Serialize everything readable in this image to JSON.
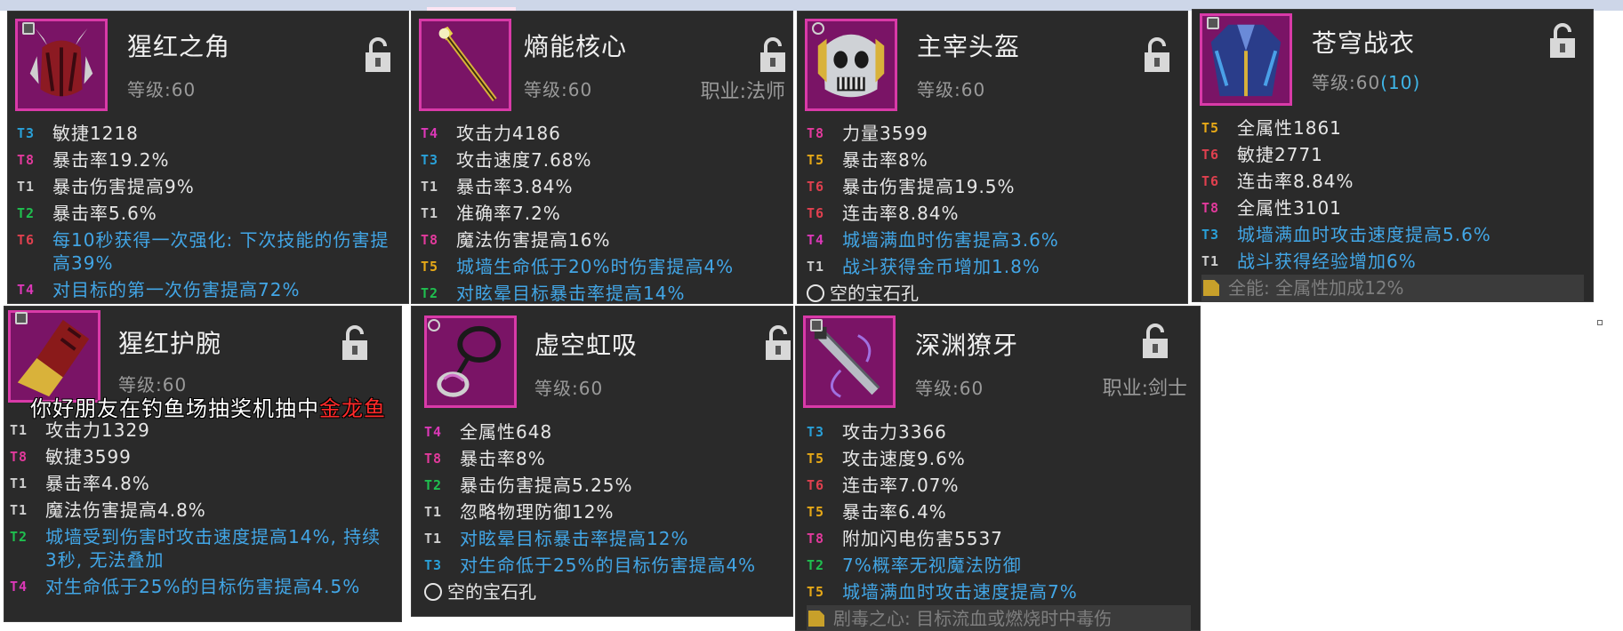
{
  "cards": [
    {
      "name": "猩红之角",
      "level": "等级:60",
      "level_bonus": "",
      "class_label": "",
      "icon": "horned-helm-icon",
      "stats": [
        {
          "tier": "T3",
          "text": "敏捷1218"
        },
        {
          "tier": "T8",
          "text": "暴击率19.2%"
        },
        {
          "tier": "T1",
          "text": "暴击伤害提高9%"
        },
        {
          "tier": "T2",
          "text": "暴击率5.6%"
        },
        {
          "tier": "T6",
          "text": "每10秒获得一次强化: 下次技能的伤害提高39%"
        },
        {
          "tier": "T4",
          "text": "对目标的第一次伤害提高72%"
        }
      ]
    },
    {
      "name": "熵能核心",
      "level": "等级:60",
      "level_bonus": "",
      "class_label": "职业:法师",
      "icon": "staff-icon",
      "stats": [
        {
          "tier": "T4",
          "text": "攻击力4186"
        },
        {
          "tier": "T3",
          "text": "攻击速度7.68%"
        },
        {
          "tier": "T1",
          "text": "暴击率3.84%"
        },
        {
          "tier": "T1",
          "text": "准确率7.2%"
        },
        {
          "tier": "T8",
          "text": "魔法伤害提高16%"
        },
        {
          "tier": "T5",
          "text": "城墙生命低于20%时伤害提高4%"
        },
        {
          "tier": "T2",
          "text": "对眩晕目标暴击率提高14%"
        }
      ]
    },
    {
      "name": "主宰头盔",
      "level": "等级:60",
      "level_bonus": "",
      "class_label": "",
      "icon": "skull-helmet-icon",
      "stats": [
        {
          "tier": "T8",
          "text": "力量3599"
        },
        {
          "tier": "T5",
          "text": "暴击率8%"
        },
        {
          "tier": "T6",
          "text": "暴击伤害提高19.5%"
        },
        {
          "tier": "T6",
          "text": "连击率8.84%"
        },
        {
          "tier": "T4",
          "text": "城墙满血时伤害提高3.6%"
        },
        {
          "tier": "T1",
          "text": "战斗获得金币增加1.8%"
        }
      ],
      "gem_slot": "空的宝石孔"
    },
    {
      "name": "苍穹战衣",
      "level": "等级:60",
      "level_bonus": "(10)",
      "class_label": "",
      "icon": "armor-robe-icon",
      "stats": [
        {
          "tier": "T5",
          "text": "全属性1861"
        },
        {
          "tier": "T6",
          "text": "敏捷2771"
        },
        {
          "tier": "T6",
          "text": "连击率8.84%"
        },
        {
          "tier": "T8",
          "text": "全属性3101"
        },
        {
          "tier": "T3",
          "text": "城墙满血时攻击速度提高5.6%"
        },
        {
          "tier": "T1",
          "text": "战斗获得经验增加6%"
        }
      ],
      "set_bonus": "全能: 全属性加成12%"
    },
    {
      "name": "猩红护腕",
      "level": "等级:60",
      "level_bonus": "",
      "class_label": "",
      "icon": "bracer-icon",
      "stats": [
        {
          "tier": "T1",
          "text": "攻击力1329"
        },
        {
          "tier": "T8",
          "text": "敏捷3599"
        },
        {
          "tier": "T1",
          "text": "暴击率4.8%"
        },
        {
          "tier": "T1",
          "text": "魔法伤害提高4.8%"
        },
        {
          "tier": "T2",
          "text": "城墙受到伤害时攻击速度提高14%, 持续3秒, 无法叠加"
        },
        {
          "tier": "T4",
          "text": "对生命低于25%的目标伤害提高4.5%"
        }
      ]
    },
    {
      "name": "虚空虹吸",
      "level": "等级:60",
      "level_bonus": "",
      "class_label": "",
      "icon": "amulet-icon",
      "stats": [
        {
          "tier": "T4",
          "text": "全属性648"
        },
        {
          "tier": "T8",
          "text": "暴击率8%"
        },
        {
          "tier": "T2",
          "text": "暴击伤害提高5.25%"
        },
        {
          "tier": "T1",
          "text": "忽略物理防御12%"
        },
        {
          "tier": "T1",
          "text": "对眩晕目标暴击率提高12%"
        },
        {
          "tier": "T3",
          "text": "对生命低于25%的目标伤害提高4%"
        }
      ],
      "gem_slot": "空的宝石孔"
    },
    {
      "name": "深渊獠牙",
      "level": "等级:60",
      "level_bonus": "",
      "class_label": "职业:剑士",
      "icon": "dagger-icon",
      "stats": [
        {
          "tier": "T3",
          "text": "攻击力3366"
        },
        {
          "tier": "T5",
          "text": "攻击速度9.6%"
        },
        {
          "tier": "T6",
          "text": "连击率7.07%"
        },
        {
          "tier": "T5",
          "text": "暴击率6.4%"
        },
        {
          "tier": "T8",
          "text": "附加闪电伤害5537"
        },
        {
          "tier": "T2",
          "text": "7%概率无视魔法防御"
        },
        {
          "tier": "T5",
          "text": "城墙满血时攻击速度提高7%"
        }
      ],
      "set_bonus": "剧毒之心: 目标流血或燃烧时中毒伤"
    }
  ],
  "overlay_message": {
    "text": "你好朋友在钓鱼场抽奖机抽中",
    "highlight": "金龙鱼"
  },
  "colors": {
    "panel_bg": "#2a2a2a",
    "icon_bg": "#7a1466",
    "icon_border": "#d93aa8",
    "blue_text": "#42a6e6"
  }
}
